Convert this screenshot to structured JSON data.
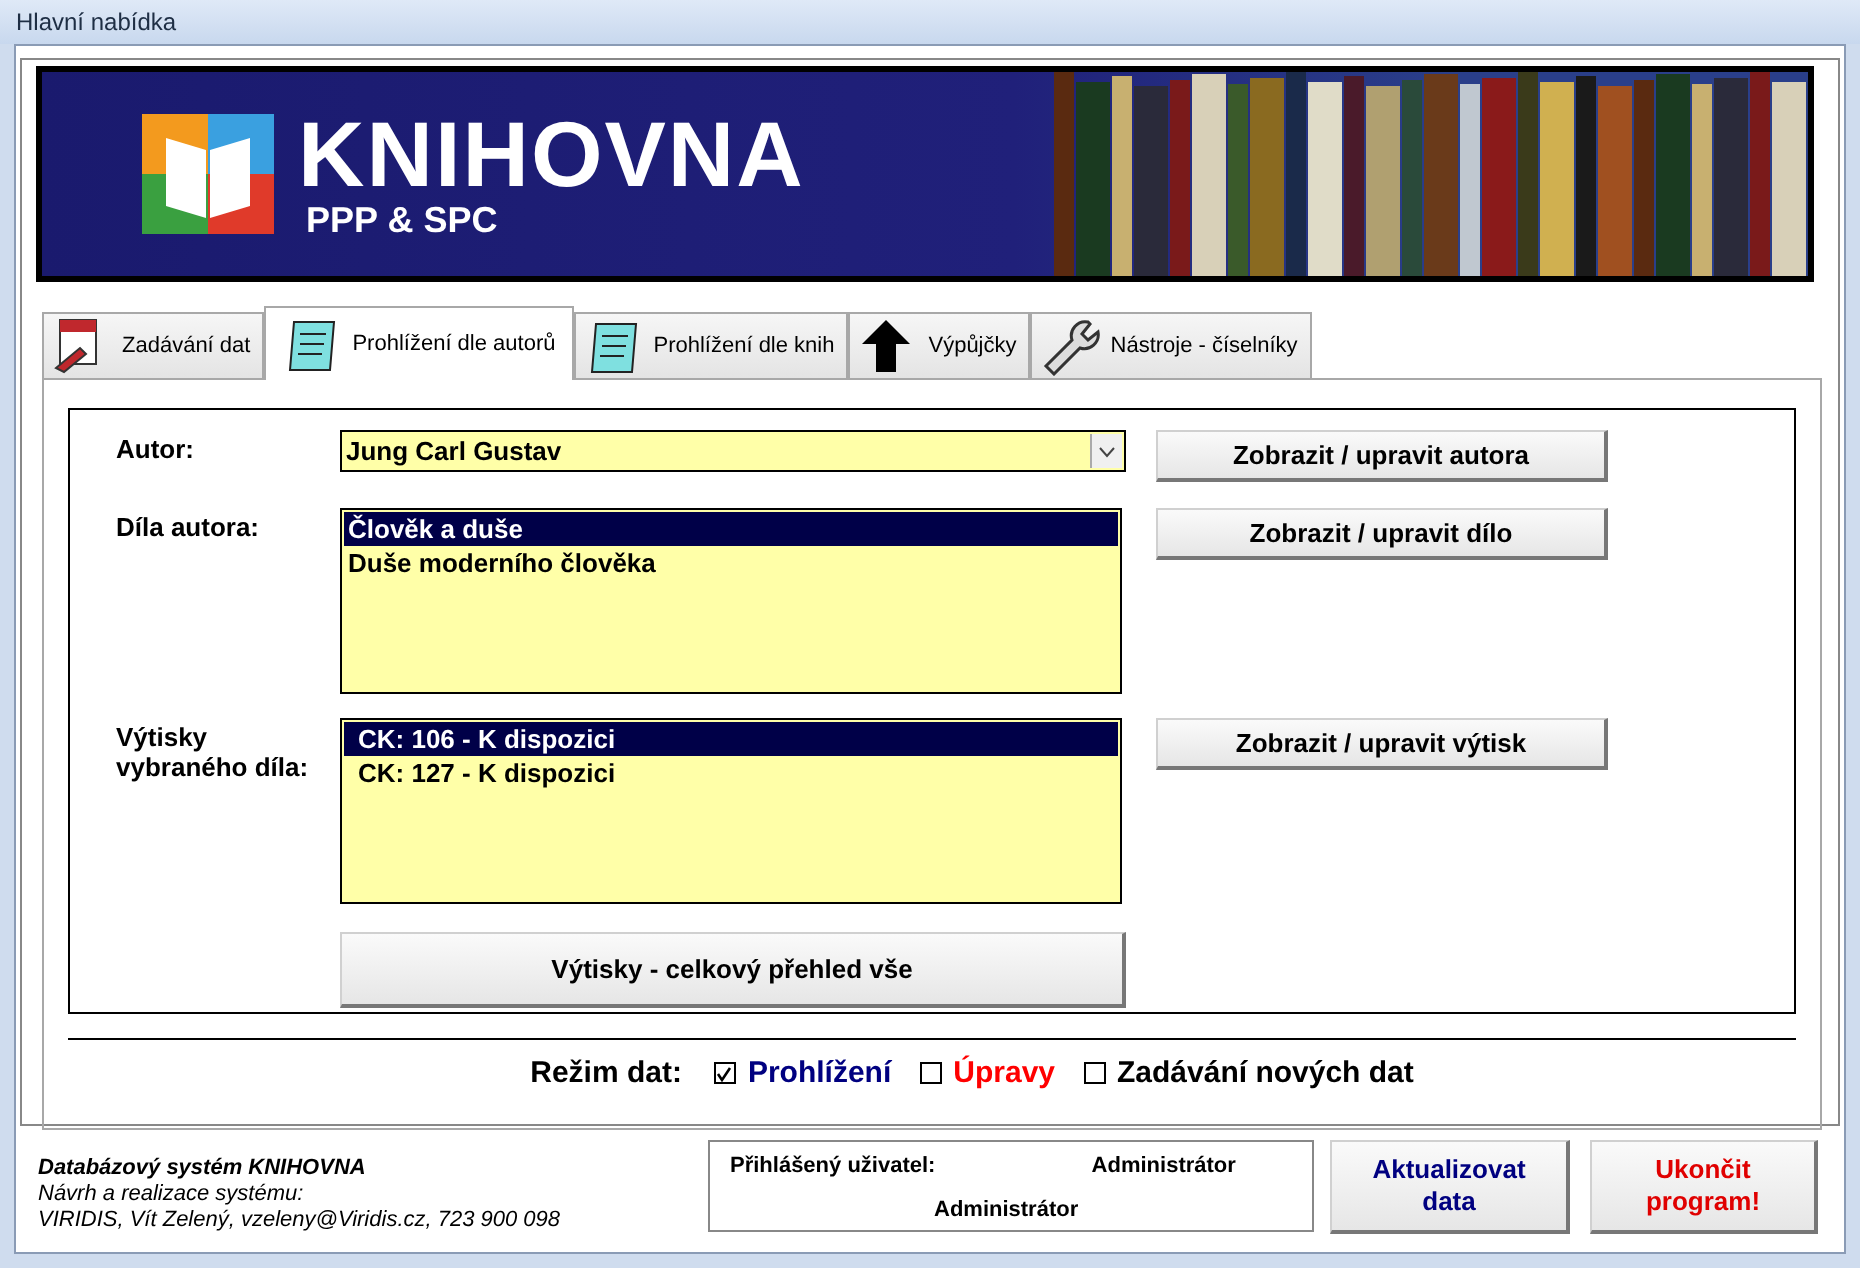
{
  "window": {
    "title": "Hlavní nabídka"
  },
  "banner": {
    "title": "KNIHOVNA",
    "subtitle": "PPP & SPC"
  },
  "tabs": [
    {
      "label": "Zadávání dat",
      "selected": false
    },
    {
      "label": "Prohlížení dle autorů",
      "selected": true
    },
    {
      "label": "Prohlížení dle knih",
      "selected": false
    },
    {
      "label": "Výpůjčky",
      "selected": false
    },
    {
      "label": "Nástroje - číselníky",
      "selected": false
    }
  ],
  "author": {
    "label": "Autor:",
    "value": "Jung Carl Gustav",
    "button": "Zobrazit / upravit autora"
  },
  "works": {
    "label": "Díla autora:",
    "button": "Zobrazit / upravit dílo",
    "items": [
      {
        "text": "Člověk a duše",
        "selected": true
      },
      {
        "text": "Duše moderního člověka",
        "selected": false
      }
    ]
  },
  "copies": {
    "label": "Výtisky vybraného díla:",
    "button": "Zobrazit / upravit výtisk",
    "items": [
      {
        "text": "CK: 106 - K dispozici",
        "selected": true
      },
      {
        "text": "CK: 127 - K dispozici",
        "selected": false
      }
    ]
  },
  "overview_button": "Výtisky - celkový přehled vše",
  "data_mode": {
    "label": "Režim dat:",
    "options": [
      {
        "label": "Prohlížení",
        "checked": true,
        "color": "#000080"
      },
      {
        "label": "Úpravy",
        "checked": false,
        "color": "#ff0000"
      },
      {
        "label": "Zadávání nových dat",
        "checked": false,
        "color": "#000000"
      }
    ]
  },
  "footer": {
    "system": "Databázový systém KNIHOVNA",
    "credit_label": "Návrh a realizace systému:",
    "credit": "VIRIDIS, Vít Zelený, vzeleny@Viridis.cz, 723 900 098"
  },
  "user_box": {
    "label": "Přihlášený uživatel:",
    "user": "Administrátor",
    "role": "Administrátor"
  },
  "buttons": [
    {
      "label": "Aktualizovat data",
      "kind": "refresh"
    },
    {
      "label": "Ukončit program!",
      "kind": "exit"
    }
  ]
}
